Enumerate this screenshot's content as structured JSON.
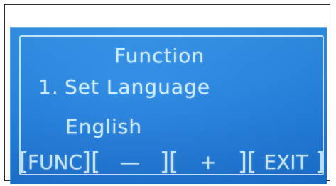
{
  "screen": {
    "title": "Function",
    "menu_number": "1.",
    "menu_label": "Set Language",
    "current_value": "English"
  },
  "softkeys": [
    {
      "label": "FUNC"
    },
    {
      "label": "—"
    },
    {
      "label": "+"
    },
    {
      "label": "EXIT"
    }
  ],
  "colors": {
    "lcd_background": "#1f7fe0",
    "lcd_text": "#cdeeff"
  }
}
